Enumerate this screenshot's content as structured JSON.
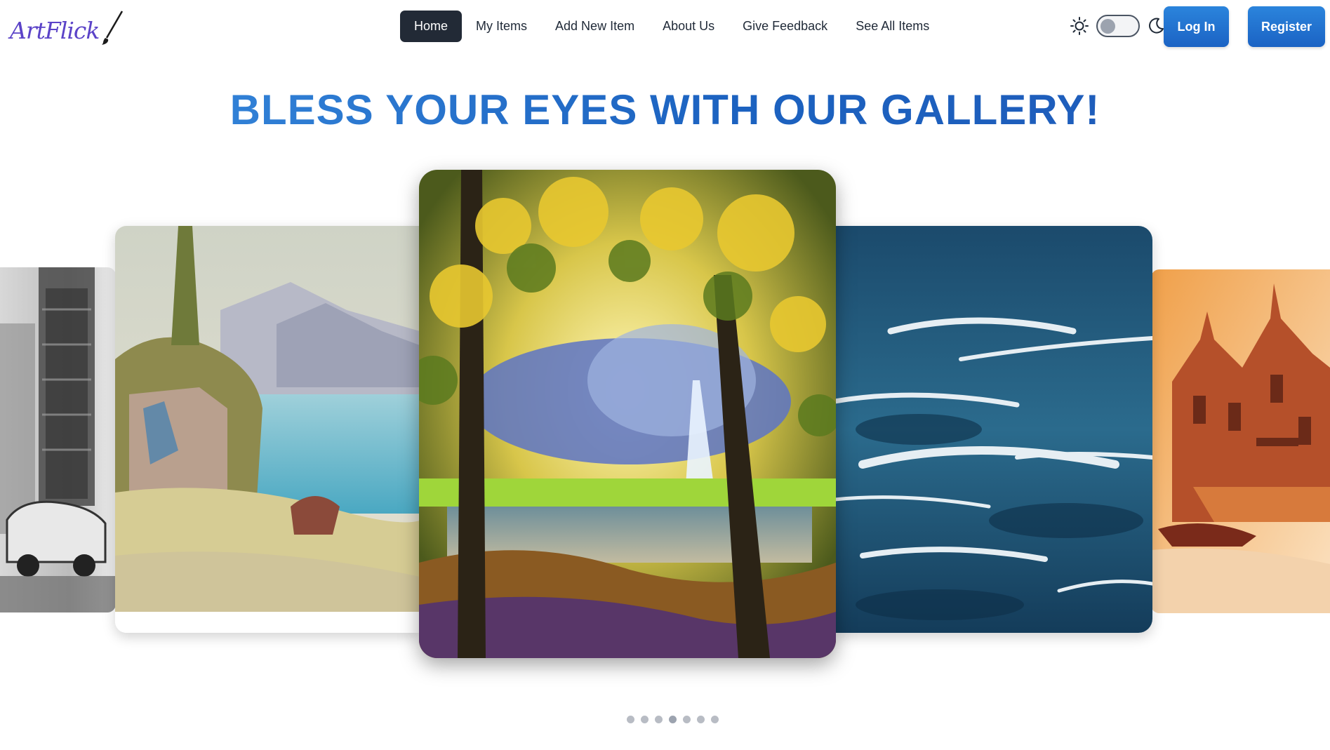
{
  "brand": {
    "logo_text": "ArtFlick",
    "logo_color": "#5b43c8"
  },
  "nav": {
    "items": [
      {
        "label": "Home",
        "active": true
      },
      {
        "label": "My Items",
        "active": false
      },
      {
        "label": "Add New Item",
        "active": false
      },
      {
        "label": "About Us",
        "active": false
      },
      {
        "label": "Give Feedback",
        "active": false
      },
      {
        "label": "See All Items",
        "active": false
      }
    ]
  },
  "theme_toggle": {
    "sun_icon": "sun-icon",
    "moon_icon": "moon-icon",
    "dark_mode": false
  },
  "auth": {
    "login_label": "Log In",
    "register_label": "Register",
    "accent_color": "#1b63c4"
  },
  "hero": {
    "title": "BLESS YOUR EYES WITH OUR GALLERY!",
    "title_color": "#1f6fd0"
  },
  "carousel": {
    "slides": [
      {
        "subject": "charcoal street sketch"
      },
      {
        "subject": "lakeside mountain landscape"
      },
      {
        "subject": "forest waterfall painting",
        "active": true
      },
      {
        "subject": "stormy sea waves"
      },
      {
        "subject": "watercolor temple by the river"
      }
    ],
    "dot_count": 7,
    "active_dot": 4
  }
}
